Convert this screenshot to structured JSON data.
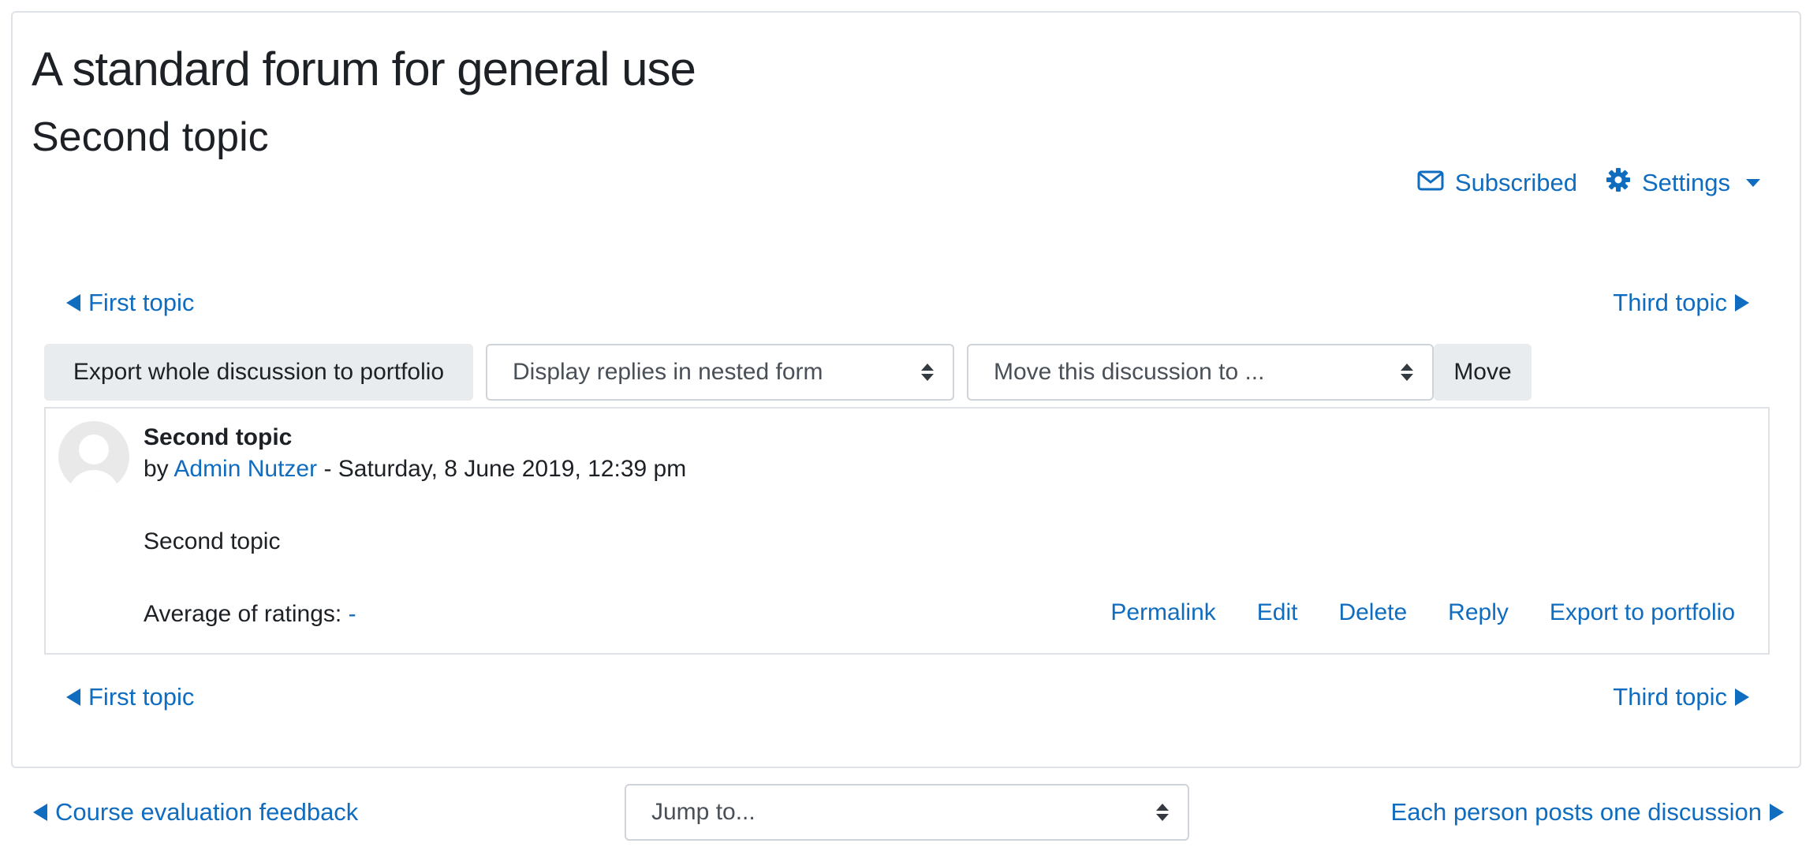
{
  "forum": {
    "title": "A standard forum for general use",
    "discussion_title": "Second topic"
  },
  "top_actions": {
    "subscribed_label": "Subscribed",
    "settings_label": "Settings"
  },
  "discussion_nav": {
    "prev_label": "First topic",
    "next_label": "Third topic"
  },
  "controls": {
    "export_button": "Export whole discussion to portfolio",
    "display_mode_selected": "Display replies in nested form",
    "move_select_selected": "Move this discussion to ...",
    "move_button": "Move"
  },
  "post": {
    "subject": "Second topic",
    "by_prefix": "by",
    "author": "Admin Nutzer",
    "date_sep": " - ",
    "date": "Saturday, 8 June 2019, 12:39 pm",
    "body": "Second topic",
    "rating_label": "Average of ratings:",
    "rating_value": "-",
    "commands": [
      "Permalink",
      "Edit",
      "Delete",
      "Reply",
      "Export to portfolio"
    ]
  },
  "activity_nav": {
    "prev_label": "Course evaluation feedback",
    "jump_selected": "Jump to...",
    "next_label": "Each person posts one discussion"
  },
  "colors": {
    "link": "#0f6cbf",
    "button_bg": "#e9ecef",
    "border": "#dee2e6"
  }
}
